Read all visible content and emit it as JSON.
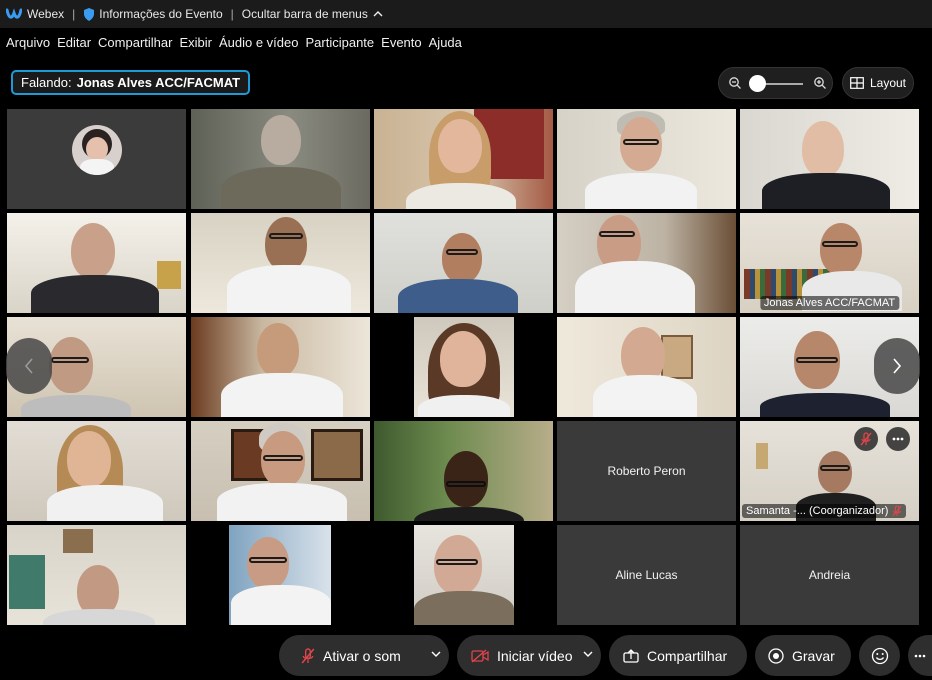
{
  "titlebar": {
    "app_name": "Webex",
    "separator": "|",
    "event_info": "Informações do Evento",
    "separator2": "|",
    "hide_menu": "Ocultar barra de menus"
  },
  "menu": [
    "Arquivo",
    "Editar",
    "Compartilhar",
    "Exibir",
    "Áudio e vídeo",
    "Participante",
    "Evento",
    "Ajuda"
  ],
  "speaking": {
    "prefix": "Falando:",
    "name": "Jonas Alves ACC/FACMAT"
  },
  "layout_button": "Layout",
  "zoom_level": 0,
  "tiles": {
    "active_label": "Jonas Alves ACC/FACMAT",
    "roberto": "Roberto Peron",
    "samanta": "Samanta -...  (Coorganizador)",
    "aline": "Aline Lucas",
    "andreia": "Andreia"
  },
  "controls": {
    "unmute": "Ativar o som",
    "start_video": "Iniciar vídeo",
    "share": "Compartilhar",
    "record": "Gravar"
  },
  "colors": {
    "accent": "#1e9bd7",
    "mute_red": "#e0454b",
    "pill_bg": "#2e2e2e"
  }
}
